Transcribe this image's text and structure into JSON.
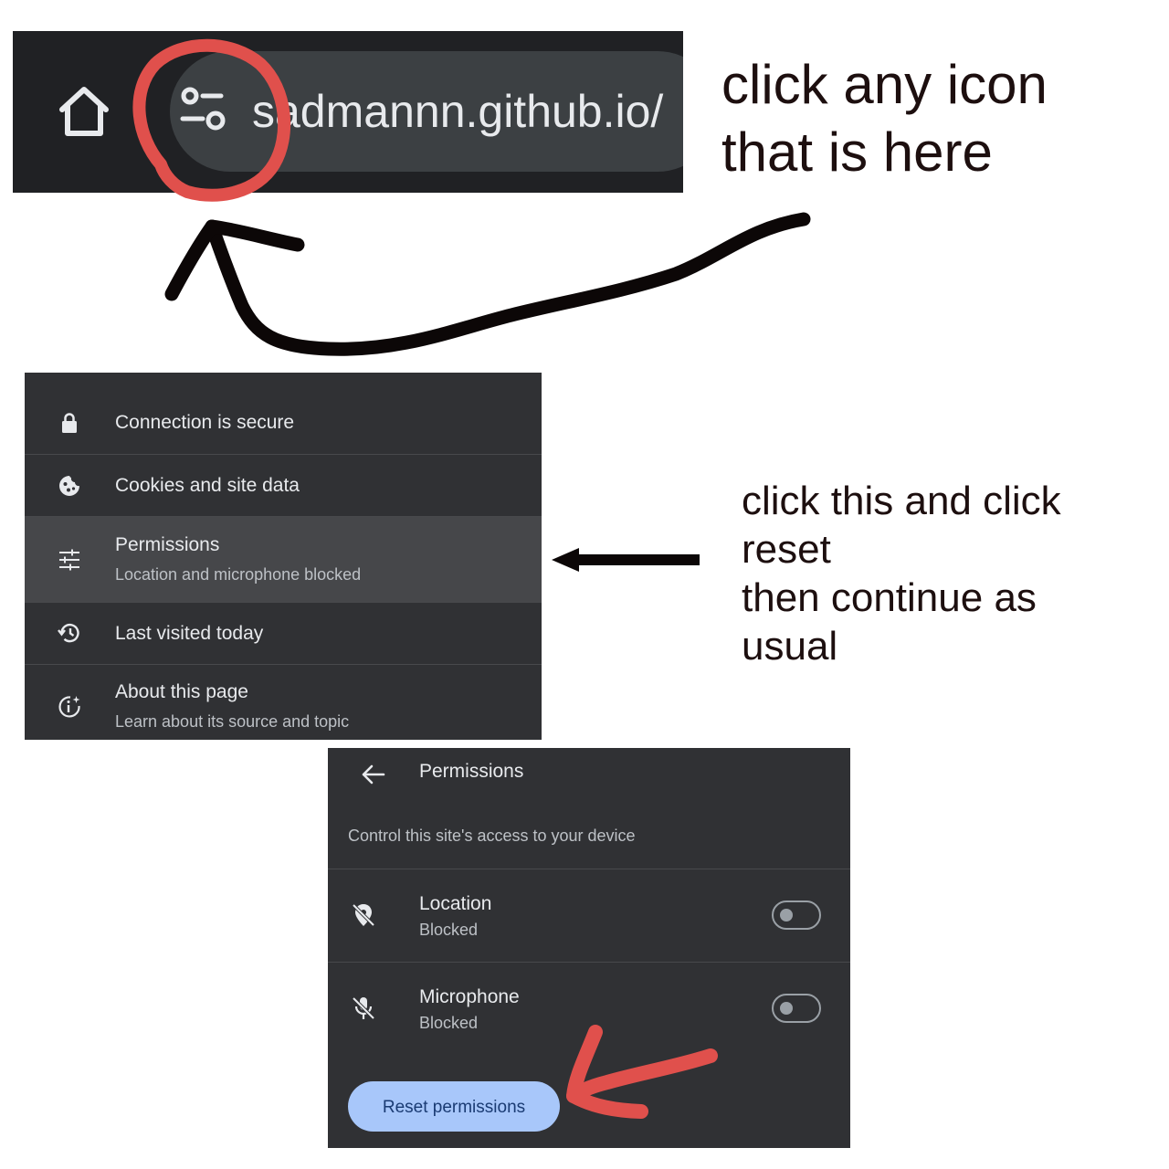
{
  "address_bar": {
    "url": "sadmannn.github.io/",
    "home_icon": "home-icon",
    "site_settings_icon": "tune-icon"
  },
  "annotations": {
    "top_note": "click any icon\nthat is here",
    "middle_note": "click this and click\nreset\nthen continue as\nusual"
  },
  "site_menu": {
    "items": [
      {
        "icon": "lock-icon",
        "title": "Connection is secure",
        "subtitle": ""
      },
      {
        "icon": "cookie-icon",
        "title": "Cookies and site data",
        "subtitle": ""
      },
      {
        "icon": "tune-icon",
        "title": "Permissions",
        "subtitle": "Location and microphone blocked",
        "highlighted": true
      },
      {
        "icon": "history-icon",
        "title": "Last visited today",
        "subtitle": ""
      },
      {
        "icon": "info-sparkle-icon",
        "title": "About this page",
        "subtitle": "Learn about its source and topic"
      }
    ]
  },
  "permissions": {
    "title": "Permissions",
    "description": "Control this site's access to your device",
    "items": [
      {
        "icon": "location-off-icon",
        "name": "Location",
        "status": "Blocked",
        "enabled": false
      },
      {
        "icon": "mic-off-icon",
        "name": "Microphone",
        "status": "Blocked",
        "enabled": false
      }
    ],
    "reset_label": "Reset permissions"
  },
  "colors": {
    "dark_bar": "#202124",
    "panel_bg": "#303134",
    "highlight_row": "#46474a",
    "reset_button_bg": "#a8c7fa",
    "annotation_red": "#e0504c",
    "annotation_black": "#0c0707"
  }
}
